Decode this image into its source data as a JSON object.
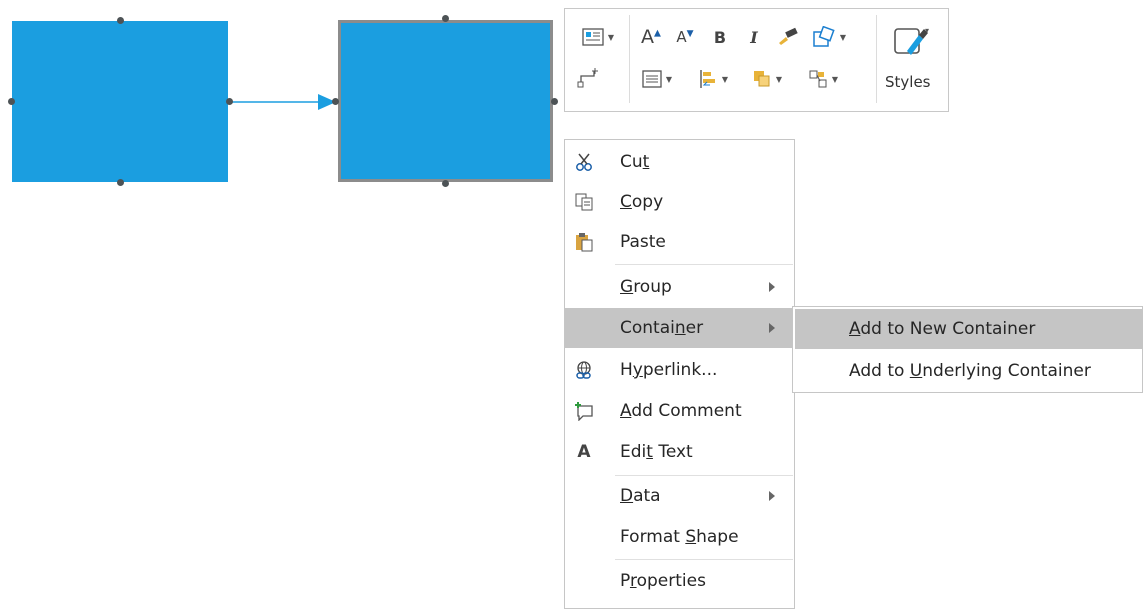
{
  "mini_toolbar": {
    "styles_label": "Styles",
    "font_size_increase": "A",
    "font_size_decrease": "A",
    "bold": "B",
    "italic": "I"
  },
  "context_menu": {
    "items": [
      {
        "id": "cut",
        "pre": "Cu",
        "ul": "t",
        "post": "",
        "icon": "scissors-icon"
      },
      {
        "id": "copy",
        "pre": "",
        "ul": "C",
        "post": "opy",
        "icon": "copy-icon"
      },
      {
        "id": "paste",
        "pre": "Paste",
        "ul": "",
        "post": "",
        "icon": "paste-icon"
      },
      {
        "id": "group",
        "pre": "",
        "ul": "G",
        "post": "roup",
        "submenu": true
      },
      {
        "id": "container",
        "pre": "Contai",
        "ul": "n",
        "post": "er",
        "submenu": true,
        "highlighted": true
      },
      {
        "id": "hyperlink",
        "pre": "H",
        "ul": "y",
        "post": "perlink...",
        "icon": "hyperlink-icon"
      },
      {
        "id": "add-comment",
        "pre": "",
        "ul": "A",
        "post": "dd Comment",
        "icon": "comment-icon"
      },
      {
        "id": "edit-text",
        "pre": "Edi",
        "ul": "t",
        "post": " Text",
        "icon": "text-icon"
      },
      {
        "id": "data",
        "pre": "",
        "ul": "D",
        "post": "ata",
        "submenu": true
      },
      {
        "id": "format-shape",
        "pre": "Format ",
        "ul": "S",
        "post": "hape"
      },
      {
        "id": "properties",
        "pre": "P",
        "ul": "r",
        "post": "operties"
      }
    ]
  },
  "submenu": {
    "items": [
      {
        "id": "add-new-container",
        "pre": "",
        "ul": "A",
        "post": "dd to New Container",
        "highlighted": true
      },
      {
        "id": "add-underlying-container",
        "pre": "Add to ",
        "ul": "U",
        "post": "nderlying Container"
      }
    ]
  },
  "colors": {
    "shape_fill": "#1b9ee0",
    "shape_border": "#8c8c8c",
    "connector": "#1b9ee0",
    "menu_highlight": "#c5c5c5"
  },
  "text_icon_glyph": "A"
}
